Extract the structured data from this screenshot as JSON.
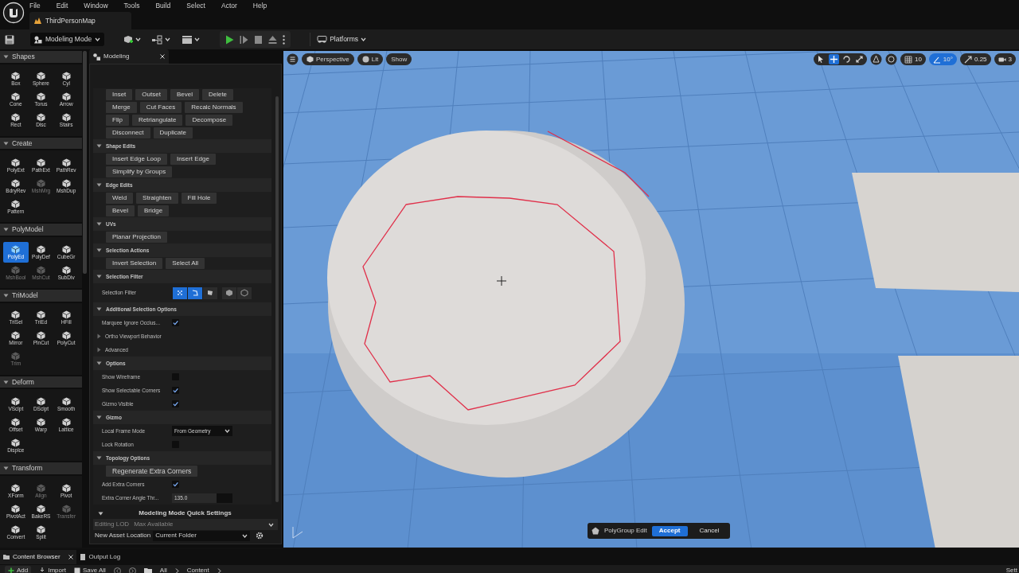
{
  "menu": [
    "File",
    "Edit",
    "Window",
    "Tools",
    "Build",
    "Select",
    "Actor",
    "Help"
  ],
  "map_tab": "ThirdPersonMap",
  "toolbar": {
    "mode": "Modeling Mode",
    "platforms": "Platforms"
  },
  "palette": [
    {
      "title": "Shapes",
      "expanded": true,
      "tools": [
        {
          "label": "Box",
          "selected": false,
          "disabled": false
        },
        {
          "label": "Sphere",
          "selected": false,
          "disabled": false
        },
        {
          "label": "Cyl",
          "selected": false,
          "disabled": false
        },
        {
          "label": "Cone",
          "selected": false,
          "disabled": false
        },
        {
          "label": "Torus",
          "selected": false,
          "disabled": false
        },
        {
          "label": "Arrow",
          "selected": false,
          "disabled": false
        },
        {
          "label": "Rect",
          "selected": false,
          "disabled": false
        },
        {
          "label": "Disc",
          "selected": false,
          "disabled": false
        },
        {
          "label": "Stairs",
          "selected": false,
          "disabled": false
        }
      ]
    },
    {
      "title": "Create",
      "expanded": true,
      "tools": [
        {
          "label": "PolyExt",
          "selected": false,
          "disabled": false
        },
        {
          "label": "PathExt",
          "selected": false,
          "disabled": false
        },
        {
          "label": "PathRev",
          "selected": false,
          "disabled": false
        },
        {
          "label": "BdryRev",
          "selected": false,
          "disabled": false
        },
        {
          "label": "MshMrg",
          "selected": false,
          "disabled": true
        },
        {
          "label": "MshDup",
          "selected": false,
          "disabled": false
        },
        {
          "label": "Pattern",
          "selected": false,
          "disabled": false
        }
      ]
    },
    {
      "title": "PolyModel",
      "expanded": true,
      "tools": [
        {
          "label": "PolyEd",
          "selected": true,
          "disabled": false
        },
        {
          "label": "PolyDef",
          "selected": false,
          "disabled": false
        },
        {
          "label": "CubeGr",
          "selected": false,
          "disabled": false
        },
        {
          "label": "MshBool",
          "selected": false,
          "disabled": true
        },
        {
          "label": "MshCut",
          "selected": false,
          "disabled": true
        },
        {
          "label": "SubDiv",
          "selected": false,
          "disabled": false
        }
      ]
    },
    {
      "title": "TriModel",
      "expanded": true,
      "tools": [
        {
          "label": "TriSel",
          "selected": false,
          "disabled": false
        },
        {
          "label": "TriEd",
          "selected": false,
          "disabled": false
        },
        {
          "label": "HFill",
          "selected": false,
          "disabled": false
        },
        {
          "label": "Mirror",
          "selected": false,
          "disabled": false
        },
        {
          "label": "PlnCut",
          "selected": false,
          "disabled": false
        },
        {
          "label": "PolyCut",
          "selected": false,
          "disabled": false
        },
        {
          "label": "Trim",
          "selected": false,
          "disabled": true
        }
      ]
    },
    {
      "title": "Deform",
      "expanded": true,
      "tools": [
        {
          "label": "VSclpt",
          "selected": false,
          "disabled": false
        },
        {
          "label": "DSclpt",
          "selected": false,
          "disabled": false
        },
        {
          "label": "Smooth",
          "selected": false,
          "disabled": false
        },
        {
          "label": "Offset",
          "selected": false,
          "disabled": false
        },
        {
          "label": "Warp",
          "selected": false,
          "disabled": false
        },
        {
          "label": "Lattice",
          "selected": false,
          "disabled": false
        },
        {
          "label": "Displce",
          "selected": false,
          "disabled": false
        }
      ]
    },
    {
      "title": "Transform",
      "expanded": true,
      "tools": [
        {
          "label": "XForm",
          "selected": false,
          "disabled": false
        },
        {
          "label": "Align",
          "selected": false,
          "disabled": true
        },
        {
          "label": "Pivot",
          "selected": false,
          "disabled": false
        },
        {
          "label": "PivotAct",
          "selected": false,
          "disabled": false
        },
        {
          "label": "BakeRS",
          "selected": false,
          "disabled": false
        },
        {
          "label": "Transfer",
          "selected": false,
          "disabled": true
        },
        {
          "label": "Convert",
          "selected": false,
          "disabled": false
        },
        {
          "label": "Split",
          "selected": false,
          "disabled": false
        }
      ]
    }
  ],
  "panel": {
    "title": "Modeling",
    "tool_buttons": [
      [
        "Inset",
        "Outset",
        "Bevel",
        "Delete"
      ],
      [
        "Merge",
        "Cut Faces",
        "Recalc Normals"
      ],
      [
        "Flip",
        "Retriangulate",
        "Decompose"
      ],
      [
        "Disconnect",
        "Duplicate"
      ]
    ],
    "sections": [
      {
        "title": "Shape Edits",
        "expanded": true,
        "rows": [
          {
            "kind": "buttons",
            "buttons": [
              "Insert Edge Loop",
              "Insert Edge"
            ]
          },
          {
            "kind": "buttons",
            "buttons": [
              "Simplify by Groups"
            ]
          }
        ]
      },
      {
        "title": "Edge Edits",
        "expanded": true,
        "rows": [
          {
            "kind": "buttons",
            "buttons": [
              "Weld",
              "Straighten",
              "Fill Hole"
            ]
          },
          {
            "kind": "buttons",
            "buttons": [
              "Bevel",
              "Bridge"
            ]
          }
        ]
      },
      {
        "title": "UVs",
        "expanded": true,
        "rows": [
          {
            "kind": "buttons",
            "buttons": [
              "Planar Projection"
            ]
          }
        ]
      },
      {
        "title": "Selection Actions",
        "expanded": true,
        "rows": [
          {
            "kind": "buttons",
            "buttons": [
              "Invert Selection",
              "Select All"
            ]
          }
        ]
      },
      {
        "title": "Selection Filter",
        "expanded": true,
        "rows": [
          {
            "kind": "filter",
            "label": "Selection Filter",
            "options": [
              {
                "selected": true
              },
              {
                "selected": true
              },
              {
                "selected": false
              },
              {
                "selected": false
              },
              {
                "selected": false
              }
            ]
          }
        ]
      },
      {
        "title": "Additional Selection Options",
        "expanded": true,
        "rows": [
          {
            "kind": "checkbox",
            "label": "Marquee Ignore Occlus...",
            "checked": true
          },
          {
            "kind": "group",
            "label": "Ortho Viewport Behavior",
            "expanded": false
          },
          {
            "kind": "group",
            "label": "Advanced",
            "expanded": false
          }
        ]
      },
      {
        "title": "Options",
        "expanded": true,
        "rows": [
          {
            "kind": "checkbox",
            "label": "Show Wireframe",
            "checked": false
          },
          {
            "kind": "checkbox",
            "label": "Show Selectable Corners",
            "checked": true
          },
          {
            "kind": "checkbox",
            "label": "Gizmo Visible",
            "checked": true
          }
        ]
      },
      {
        "title": "Gizmo",
        "expanded": true,
        "rows": [
          {
            "kind": "dropdown",
            "label": "Local Frame Mode",
            "value": "From Geometry"
          },
          {
            "kind": "checkbox",
            "label": "Lock Rotation",
            "checked": false
          }
        ]
      },
      {
        "title": "Topology Options",
        "expanded": true,
        "rows": [
          {
            "kind": "buttons",
            "buttons": [
              "Regenerate Extra Corners"
            ]
          },
          {
            "kind": "checkbox",
            "label": "Add Extra Corners",
            "checked": true
          },
          {
            "kind": "number",
            "label": "Extra Corner Angle Thr...",
            "value": "135.0"
          }
        ]
      }
    ],
    "quick_settings": {
      "title": "Modeling Mode Quick Settings",
      "editing_lod": {
        "label": "Editing LOD",
        "value": "Max Available",
        "disabled": true
      },
      "asset_location": {
        "label": "New Asset Location",
        "value": "Current Folder",
        "disabled": false
      }
    }
  },
  "viewport": {
    "buttons": [
      "Perspective",
      "Lit",
      "Show"
    ],
    "grid": "10",
    "angle": "10°",
    "scale": "0.25",
    "camera": "3"
  },
  "overlay": {
    "label": "PolyGroup Edit",
    "accept": "Accept",
    "cancel": "Cancel"
  },
  "bottom_tabs": [
    {
      "label": "Content Browser",
      "selected": true
    },
    {
      "label": "Output Log",
      "selected": false
    }
  ],
  "content_toolbar": {
    "add": "Add",
    "import": "Import",
    "save_all": "Save All",
    "path": [
      "All",
      "Content"
    ],
    "settings": "Sett"
  }
}
